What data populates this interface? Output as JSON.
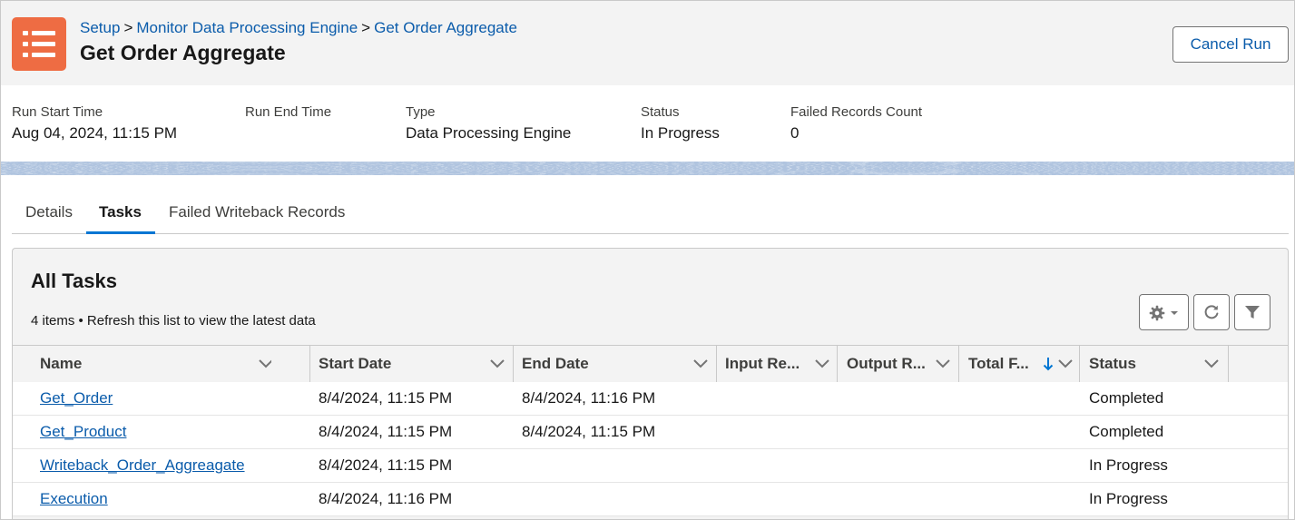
{
  "breadcrumb": {
    "items": [
      "Setup",
      "Monitor Data Processing Engine",
      "Get Order Aggregate"
    ],
    "separator": ">"
  },
  "header": {
    "title": "Get Order Aggregate",
    "cancel_label": "Cancel Run",
    "icon": "list-icon",
    "icon_color": "#ee6c43"
  },
  "highlights": {
    "run_start": {
      "label": "Run Start Time",
      "value": "Aug 04, 2024, 11:15 PM"
    },
    "run_end": {
      "label": "Run End Time",
      "value": ""
    },
    "type": {
      "label": "Type",
      "value": "Data Processing Engine"
    },
    "status": {
      "label": "Status",
      "value": "In Progress"
    },
    "failed_count": {
      "label": "Failed Records Count",
      "value": "0"
    }
  },
  "tabs": [
    {
      "label": "Details",
      "active": false
    },
    {
      "label": "Tasks",
      "active": true
    },
    {
      "label": "Failed Writeback Records",
      "active": false
    }
  ],
  "list": {
    "title": "All Tasks",
    "meta": "4 items • Refresh this list to view the latest data",
    "columns": [
      "Name",
      "Start Date",
      "End Date",
      "Input Re...",
      "Output R...",
      "Total F...",
      "Status"
    ],
    "sorted_column": "Total F...",
    "sort_direction": "descending",
    "rows": [
      {
        "name": "Get_Order",
        "start": "8/4/2024, 11:15 PM",
        "end": "8/4/2024, 11:16 PM",
        "input": "",
        "output": "",
        "total": "",
        "status": "Completed"
      },
      {
        "name": "Get_Product",
        "start": "8/4/2024, 11:15 PM",
        "end": "8/4/2024, 11:15 PM",
        "input": "",
        "output": "",
        "total": "",
        "status": "Completed"
      },
      {
        "name": "Writeback_Order_Aggreagate",
        "start": "8/4/2024, 11:15 PM",
        "end": "",
        "input": "",
        "output": "",
        "total": "",
        "status": "In Progress"
      },
      {
        "name": "Execution",
        "start": "8/4/2024, 11:16 PM",
        "end": "",
        "input": "",
        "output": "",
        "total": "",
        "status": "In Progress"
      }
    ]
  },
  "colors": {
    "link": "#0b5cab",
    "brand_blue": "#0176d3",
    "header_bg": "#f3f3f3"
  }
}
